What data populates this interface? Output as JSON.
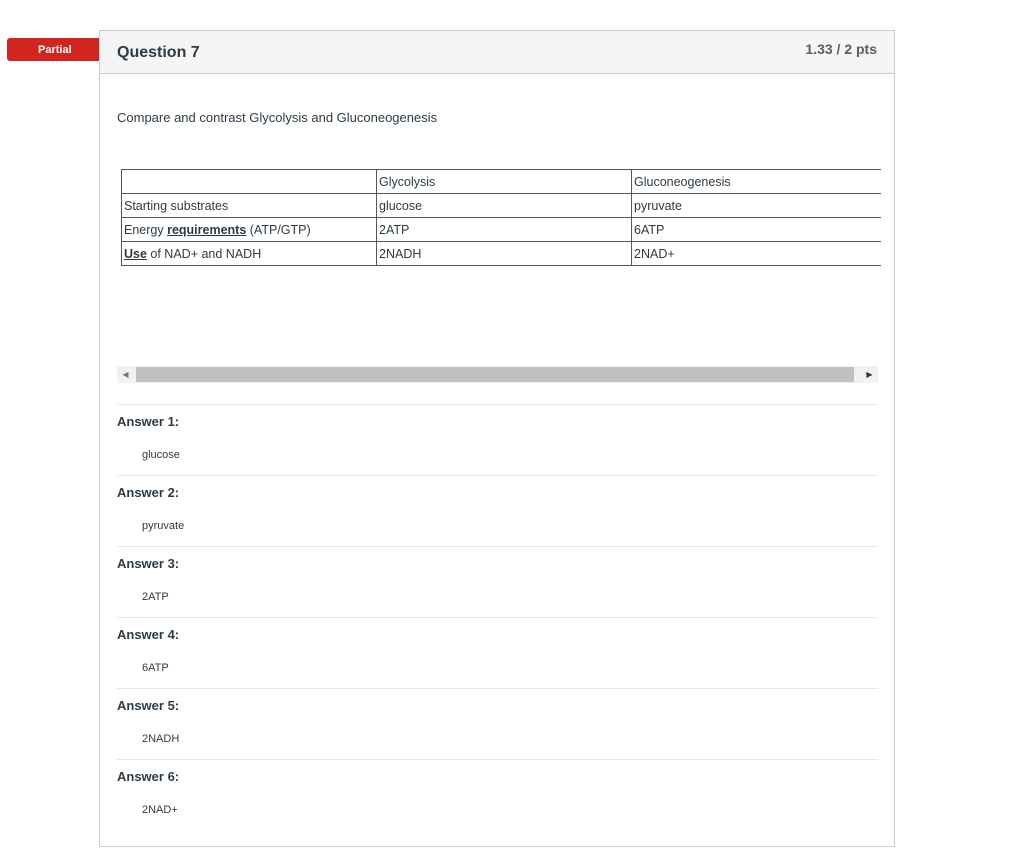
{
  "badge": {
    "label": "Partial"
  },
  "question": {
    "title": "Question 7",
    "points": "1.33 / 2 pts",
    "text": "Compare and contrast Glycolysis and Gluconeogenesis"
  },
  "table": {
    "header": [
      "",
      "Glycolysis",
      "Gluconeogenesis"
    ],
    "rows": [
      {
        "label_pre": "Starting substrates",
        "label_link": "",
        "label_post": "",
        "col1": "glucose",
        "col2": "pyruvate"
      },
      {
        "label_pre": "Energy ",
        "label_link": "requirements",
        "label_post": " (ATP/GTP)",
        "col1": "2ATP",
        "col2": "6ATP"
      },
      {
        "label_pre": "",
        "label_link": "Use",
        "label_post": " of NAD+ and NADH",
        "col1": "2NADH",
        "col2": "2NAD+"
      }
    ]
  },
  "answers": [
    {
      "label": "Answer 1:",
      "value": "glucose"
    },
    {
      "label": "Answer 2:",
      "value": "pyruvate"
    },
    {
      "label": "Answer 3:",
      "value": "2ATP"
    },
    {
      "label": "Answer 4:",
      "value": "6ATP"
    },
    {
      "label": "Answer 5:",
      "value": "2NADH"
    },
    {
      "label": "Answer 6:",
      "value": "2NAD+"
    }
  ],
  "colors": {
    "badge": "#d0261f",
    "border": "#c7cdd1",
    "text": "#2d3b45"
  }
}
